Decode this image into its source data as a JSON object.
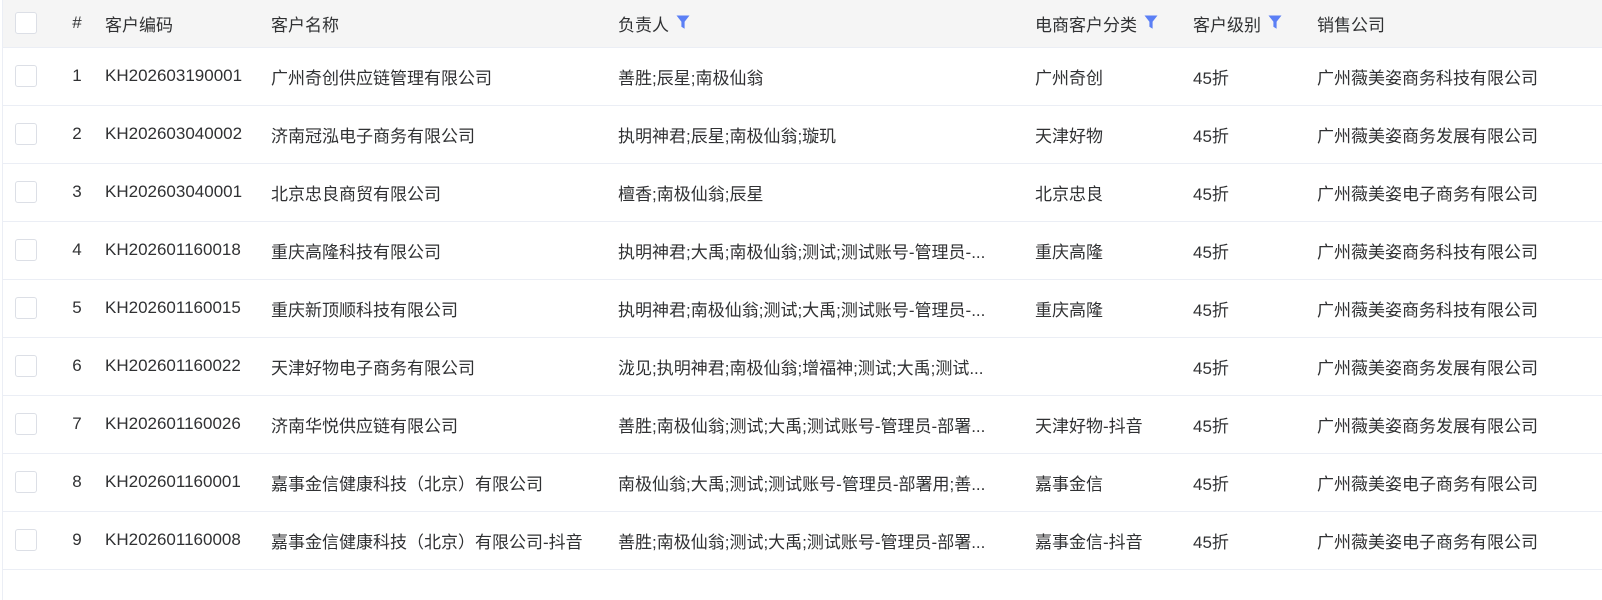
{
  "colors": {
    "filter_icon": "#5b7ff5",
    "header_bg": "#f5f5f5",
    "border": "#ebeef5"
  },
  "table": {
    "headers": {
      "index": "#",
      "code": "客户编码",
      "name": "客户名称",
      "owner": "负责人",
      "category": "电商客户分类",
      "level": "客户级别",
      "sales_company": "销售公司"
    },
    "filter_icons": [
      "owner",
      "category",
      "level"
    ],
    "rows": [
      {
        "index": "1",
        "code": "KH202603190001",
        "name": "广州奇创供应链管理有限公司",
        "owner": "善胜;辰星;南极仙翁",
        "category": "广州奇创",
        "level": "45折",
        "sales_company": "广州薇美姿商务科技有限公司"
      },
      {
        "index": "2",
        "code": "KH202603040002",
        "name": "济南冠泓电子商务有限公司",
        "owner": "执明神君;辰星;南极仙翁;璇玑",
        "category": "天津好物",
        "level": "45折",
        "sales_company": "广州薇美姿商务发展有限公司"
      },
      {
        "index": "3",
        "code": "KH202603040001",
        "name": "北京忠良商贸有限公司",
        "owner": "檀香;南极仙翁;辰星",
        "category": "北京忠良",
        "level": "45折",
        "sales_company": "广州薇美姿电子商务有限公司"
      },
      {
        "index": "4",
        "code": "KH202601160018",
        "name": "重庆高隆科技有限公司",
        "owner": "执明神君;大禹;南极仙翁;测试;测试账号-管理员-...",
        "category": "重庆高隆",
        "level": "45折",
        "sales_company": "广州薇美姿商务科技有限公司"
      },
      {
        "index": "5",
        "code": "KH202601160015",
        "name": "重庆新顶顺科技有限公司",
        "owner": "执明神君;南极仙翁;测试;大禹;测试账号-管理员-...",
        "category": "重庆高隆",
        "level": "45折",
        "sales_company": "广州薇美姿商务科技有限公司"
      },
      {
        "index": "6",
        "code": "KH202601160022",
        "name": "天津好物电子商务有限公司",
        "owner": "泷见;执明神君;南极仙翁;增福神;测试;大禹;测试...",
        "category": "",
        "level": "45折",
        "sales_company": "广州薇美姿商务发展有限公司"
      },
      {
        "index": "7",
        "code": "KH202601160026",
        "name": "济南华悦供应链有限公司",
        "owner": "善胜;南极仙翁;测试;大禹;测试账号-管理员-部署...",
        "category": "天津好物-抖音",
        "level": "45折",
        "sales_company": "广州薇美姿商务发展有限公司"
      },
      {
        "index": "8",
        "code": "KH202601160001",
        "name": "嘉事金信健康科技（北京）有限公司",
        "owner": "南极仙翁;大禹;测试;测试账号-管理员-部署用;善...",
        "category": "嘉事金信",
        "level": "45折",
        "sales_company": "广州薇美姿电子商务有限公司"
      },
      {
        "index": "9",
        "code": "KH202601160008",
        "name": "嘉事金信健康科技（北京）有限公司-抖音",
        "owner": "善胜;南极仙翁;测试;大禹;测试账号-管理员-部署...",
        "category": "嘉事金信-抖音",
        "level": "45折",
        "sales_company": "广州薇美姿电子商务有限公司"
      }
    ]
  }
}
